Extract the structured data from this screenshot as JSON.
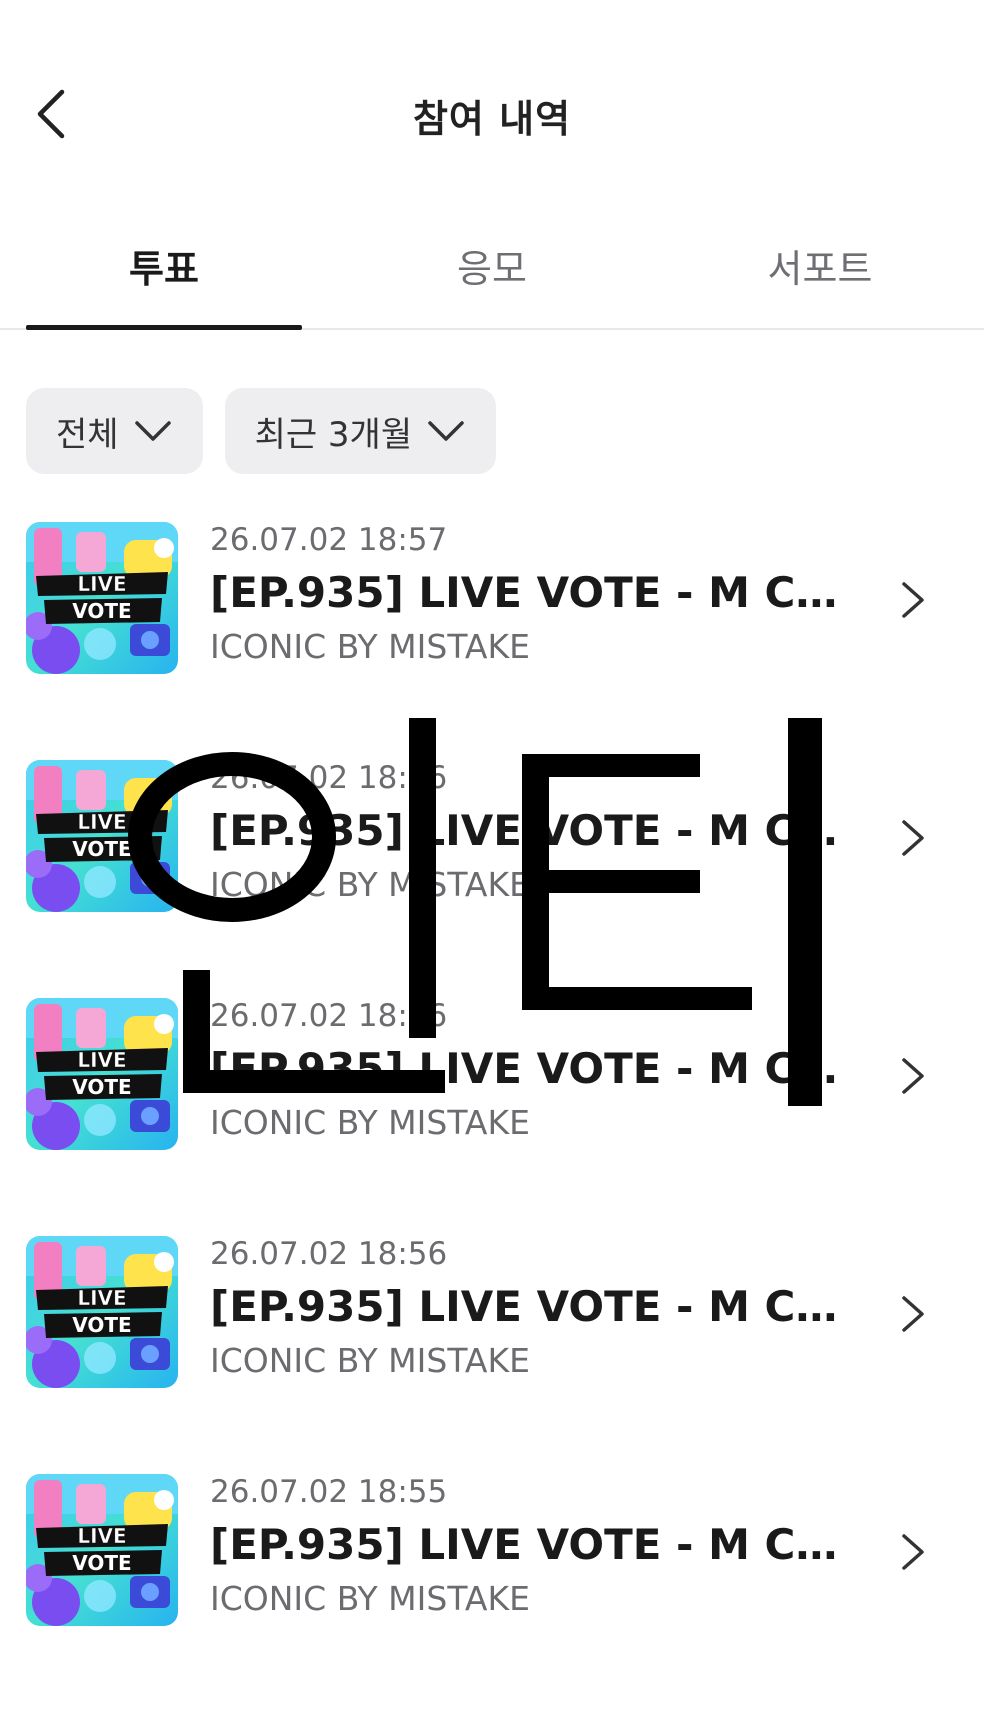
{
  "header": {
    "title": "참여 내역",
    "back_icon": "chevron-left-icon"
  },
  "tabs": [
    {
      "label": "투표",
      "active": true
    },
    {
      "label": "응모",
      "active": false
    },
    {
      "label": "서포트",
      "active": false
    }
  ],
  "filters": {
    "category": {
      "label": "전체",
      "icon": "chevron-down-icon"
    },
    "period": {
      "label": "최근 3개월",
      "icon": "chevron-down-icon"
    }
  },
  "items": [
    {
      "date": "26.07.02 18:57",
      "title": "[EP.935] LIVE VOTE - M COU...",
      "subtitle": "ICONIC BY MISTAKE",
      "thumb_label": [
        "LIVE",
        "VOTE"
      ]
    },
    {
      "date": "26.07.02 18:56",
      "title": "[EP.935] LIVE VOTE - M COU...",
      "subtitle": "ICONIC BY MISTAKE",
      "thumb_label": [
        "LIVE",
        "VOTE"
      ]
    },
    {
      "date": "26.07.02 18:56",
      "title": "[EP.935] LIVE VOTE - M COU...",
      "subtitle": "ICONIC BY MISTAKE",
      "thumb_label": [
        "LIVE",
        "VOTE"
      ]
    },
    {
      "date": "26.07.02 18:56",
      "title": "[EP.935] LIVE VOTE - M COU...",
      "subtitle": "ICONIC BY MISTAKE",
      "thumb_label": [
        "LIVE",
        "VOTE"
      ]
    },
    {
      "date": "26.07.02 18:55",
      "title": "[EP.935] LIVE VOTE - M COU...",
      "subtitle": "ICONIC BY MISTAKE",
      "thumb_label": [
        "LIVE",
        "VOTE"
      ]
    }
  ],
  "watermark": {
    "text": "인티"
  },
  "colors": {
    "accent": "#1a1a1a",
    "muted_text": "#6b6b70",
    "chip_bg": "#eeeef0",
    "divider": "#e8e8ea"
  }
}
